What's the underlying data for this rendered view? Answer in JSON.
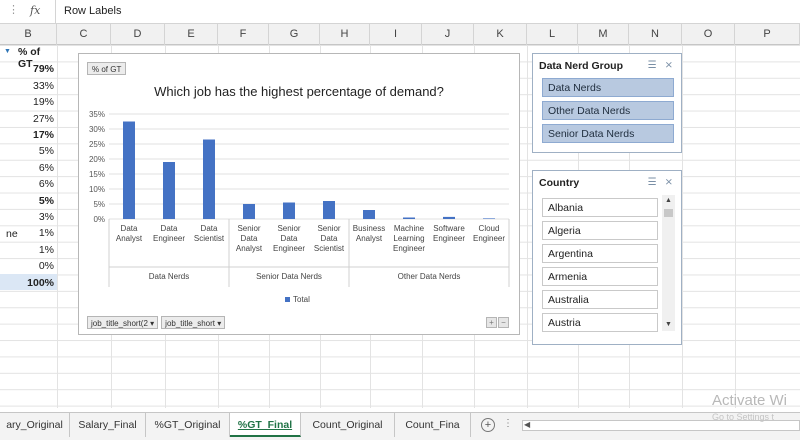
{
  "formula_bar": {
    "dots": "⋮",
    "fx": "fx",
    "text": "Row Labels"
  },
  "columns": [
    "B",
    "C",
    "D",
    "E",
    "F",
    "G",
    "H",
    "I",
    "J",
    "K",
    "L",
    "M",
    "N",
    "O",
    "P"
  ],
  "col_b": {
    "header": "% of GT",
    "values": [
      "79%",
      "33%",
      "19%",
      "27%",
      "17%",
      "5%",
      "6%",
      "6%",
      "5%",
      "3%",
      "1%",
      "1%",
      "0%",
      "100%"
    ],
    "bold_indices": [
      0,
      4,
      8,
      13
    ],
    "partial_a_text": "ne"
  },
  "chart": {
    "field_button": "% of GT",
    "title": "Which job has the highest percentage of demand?",
    "axis_buttons": [
      "job_title_short(2 ▾",
      "job_title_short ▾"
    ],
    "collapse_buttons": [
      "+",
      "−"
    ]
  },
  "chart_data": {
    "type": "bar",
    "title": "Which job has the highest percentage of demand?",
    "categories": [
      [
        "Data",
        "Analyst"
      ],
      [
        "Data",
        "Engineer"
      ],
      [
        "Data",
        "Scientist"
      ],
      [
        "Senior",
        "Data",
        "Analyst"
      ],
      [
        "Senior",
        "Data",
        "Engineer"
      ],
      [
        "Senior",
        "Data",
        "Scientist"
      ],
      [
        "Business",
        "Analyst"
      ],
      [
        "Machine",
        "Learning",
        "Engineer"
      ],
      [
        "Software",
        "Engineer"
      ],
      [
        "Cloud",
        "Engineer"
      ]
    ],
    "groups": [
      {
        "name": "Data Nerds",
        "start": 0,
        "end": 2
      },
      {
        "name": "Senior Data Nerds",
        "start": 3,
        "end": 5
      },
      {
        "name": "Other Data Nerds",
        "start": 6,
        "end": 9
      }
    ],
    "series": [
      {
        "name": "Total",
        "values": [
          32.5,
          19,
          26.5,
          5,
          5.5,
          6,
          3,
          0.5,
          0.7,
          0.2
        ]
      }
    ],
    "ylim": [
      0,
      35
    ],
    "yticks": [
      "0%",
      "5%",
      "10%",
      "15%",
      "20%",
      "25%",
      "30%",
      "35%"
    ],
    "legend": "bottom",
    "grid": true,
    "bar_color": "#4472c4"
  },
  "slicer_group": {
    "title": "Data Nerd Group",
    "icons": [
      "multi-select-icon",
      "clear-filter-icon"
    ],
    "items": [
      "Data Nerds",
      "Other Data Nerds",
      "Senior Data Nerds"
    ]
  },
  "slicer_country": {
    "title": "Country",
    "icons": [
      "multi-select-icon",
      "clear-filter-icon"
    ],
    "items": [
      "Albania",
      "Algeria",
      "Argentina",
      "Armenia",
      "Australia",
      "Austria"
    ]
  },
  "tabs": {
    "items": [
      "ary_Original",
      "Salary_Final",
      "%GT_Original",
      "%GT_Final",
      "Count_Original",
      "Count_Fina"
    ],
    "active": "%GT_Final",
    "add": "+",
    "more": "⋮"
  },
  "watermark": {
    "line1": "Activate Wi",
    "line2": "Go to Settings t"
  }
}
